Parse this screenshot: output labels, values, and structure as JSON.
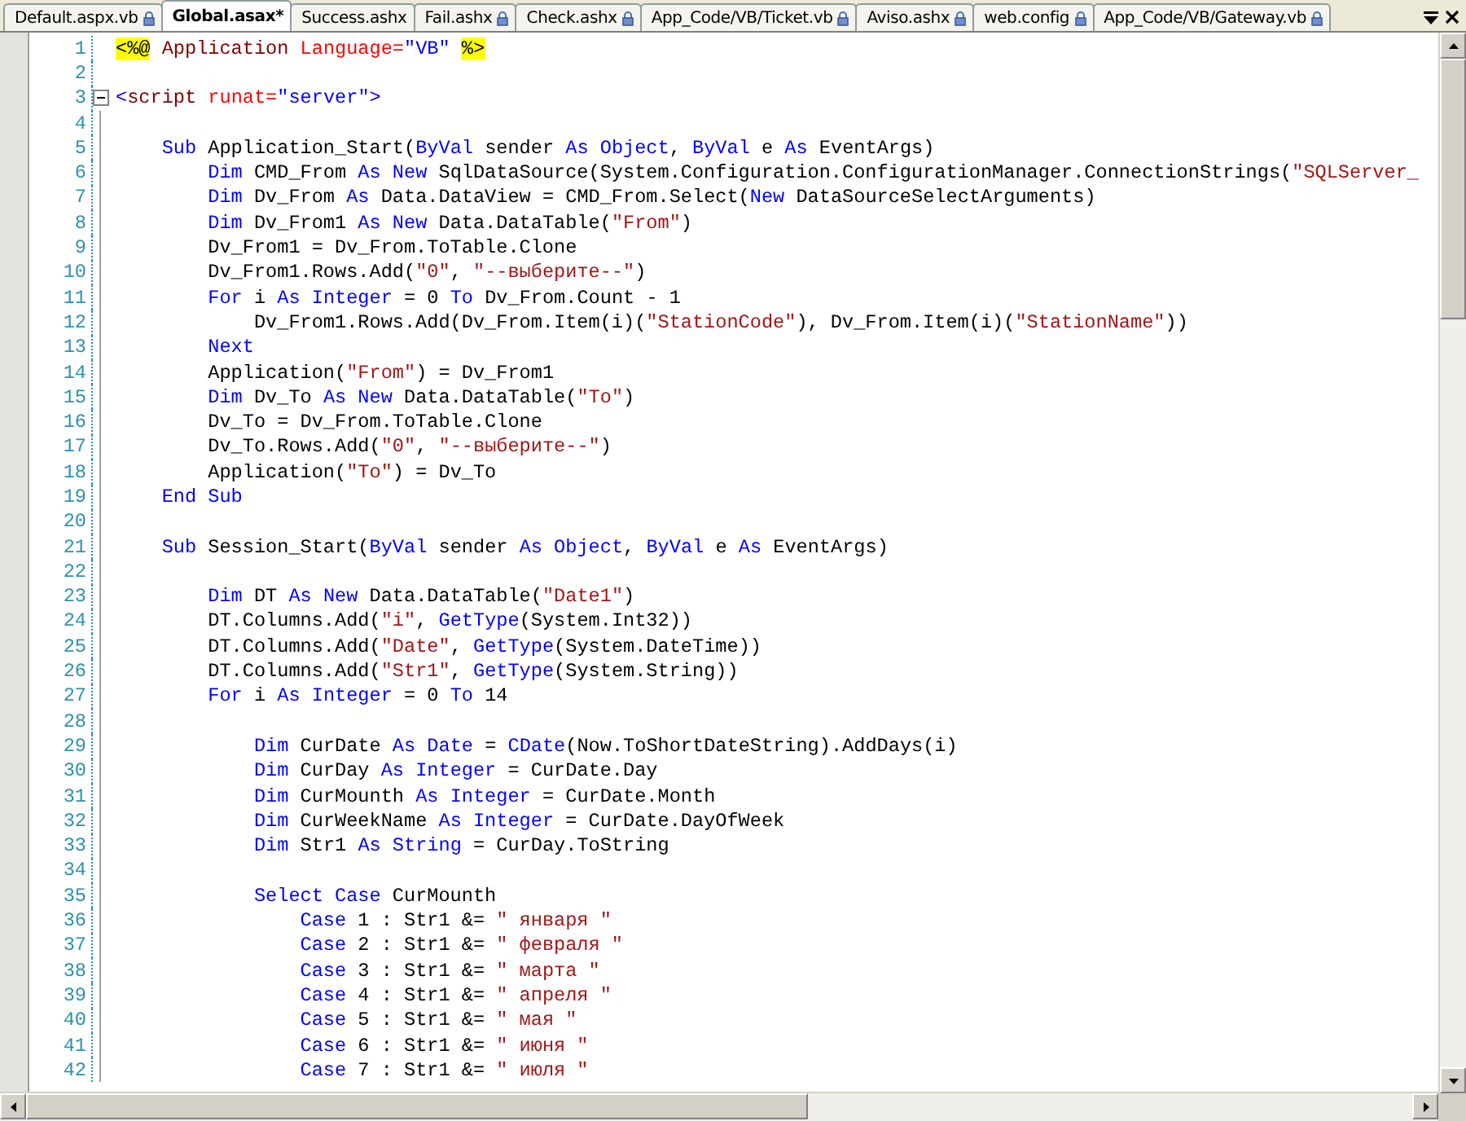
{
  "tabs": [
    {
      "label": "Default.aspx.vb",
      "selected": false,
      "locked": true
    },
    {
      "label": "Global.asax*",
      "selected": true,
      "locked": false
    },
    {
      "label": "Success.ashx",
      "selected": false,
      "locked": false
    },
    {
      "label": "Fail.ashx",
      "selected": false,
      "locked": true
    },
    {
      "label": "Check.ashx",
      "selected": false,
      "locked": true
    },
    {
      "label": "App_Code/VB/Ticket.vb",
      "selected": false,
      "locked": true
    },
    {
      "label": "Aviso.ashx",
      "selected": false,
      "locked": true
    },
    {
      "label": "web.config",
      "selected": false,
      "locked": true
    },
    {
      "label": "App_Code/VB/Gateway.vb",
      "selected": false,
      "locked": true
    }
  ],
  "lines": [
    {
      "number": "1",
      "segments": [
        {
          "kind": "asp",
          "text": "<%@"
        },
        {
          "kind": "el",
          "text": " Application"
        },
        {
          "kind": "attr",
          "text": " Language="
        },
        {
          "kind": "val",
          "text": "\"VB\" "
        },
        {
          "kind": "asp",
          "text": "%>"
        }
      ]
    },
    {
      "number": "2"
    },
    {
      "number": "3",
      "expanded": true,
      "segments": [
        {
          "kind": "val",
          "text": "<"
        },
        {
          "kind": "el",
          "text": "script"
        },
        {
          "kind": "attr",
          "text": " runat="
        },
        {
          "kind": "val",
          "text": "\"server\">"
        }
      ]
    },
    {
      "number": "4"
    },
    {
      "number": "5",
      "segments": [
        {
          "kind": "kw",
          "text": "    Sub"
        },
        {
          "kind": "plain",
          "text": " Application_Start("
        },
        {
          "kind": "kw",
          "text": "ByVal"
        },
        {
          "kind": "plain",
          "text": " sender "
        },
        {
          "kind": "kw",
          "text": "As Object"
        },
        {
          "kind": "plain",
          "text": ", "
        },
        {
          "kind": "kw",
          "text": "ByVal"
        },
        {
          "kind": "plain",
          "text": " e "
        },
        {
          "kind": "kw",
          "text": "As"
        },
        {
          "kind": "plain",
          "text": " EventArgs)"
        }
      ]
    },
    {
      "number": "6",
      "segments": [
        {
          "kind": "kw",
          "text": "        Dim"
        },
        {
          "kind": "plain",
          "text": " CMD_From "
        },
        {
          "kind": "kw",
          "text": "As New"
        },
        {
          "kind": "plain",
          "text": " SqlDataSource(System.Configuration.ConfigurationManager.ConnectionStrings("
        },
        {
          "kind": "str",
          "text": "\"SQLServer_"
        }
      ]
    },
    {
      "number": "7",
      "segments": [
        {
          "kind": "kw",
          "text": "        Dim"
        },
        {
          "kind": "plain",
          "text": " Dv_From "
        },
        {
          "kind": "kw",
          "text": "As"
        },
        {
          "kind": "plain",
          "text": " Data.DataView = CMD_From.Select("
        },
        {
          "kind": "kw",
          "text": "New"
        },
        {
          "kind": "plain",
          "text": " DataSourceSelectArguments)"
        }
      ]
    },
    {
      "number": "8",
      "segments": [
        {
          "kind": "kw",
          "text": "        Dim"
        },
        {
          "kind": "plain",
          "text": " Dv_From1 "
        },
        {
          "kind": "kw",
          "text": "As New"
        },
        {
          "kind": "plain",
          "text": " Data.DataTable("
        },
        {
          "kind": "str",
          "text": "\"From\""
        },
        {
          "kind": "plain",
          "text": ")"
        }
      ]
    },
    {
      "number": "9",
      "segments": [
        {
          "kind": "plain",
          "text": "        Dv_From1 = Dv_From.ToTable.Clone"
        }
      ]
    },
    {
      "number": "10",
      "segments": [
        {
          "kind": "plain",
          "text": "        Dv_From1.Rows.Add("
        },
        {
          "kind": "str",
          "text": "\"0\""
        },
        {
          "kind": "plain",
          "text": ", "
        },
        {
          "kind": "str",
          "text": "\"--выберите--\""
        },
        {
          "kind": "plain",
          "text": ")"
        }
      ]
    },
    {
      "number": "11",
      "segments": [
        {
          "kind": "kw",
          "text": "        For"
        },
        {
          "kind": "plain",
          "text": " i "
        },
        {
          "kind": "kw",
          "text": "As Integer"
        },
        {
          "kind": "plain",
          "text": " = 0 "
        },
        {
          "kind": "kw",
          "text": "To"
        },
        {
          "kind": "plain",
          "text": " Dv_From.Count - 1"
        }
      ]
    },
    {
      "number": "12",
      "segments": [
        {
          "kind": "plain",
          "text": "            Dv_From1.Rows.Add(Dv_From.Item(i)("
        },
        {
          "kind": "str",
          "text": "\"StationCode\""
        },
        {
          "kind": "plain",
          "text": "), Dv_From.Item(i)("
        },
        {
          "kind": "str",
          "text": "\"StationName\""
        },
        {
          "kind": "plain",
          "text": "))"
        }
      ]
    },
    {
      "number": "13",
      "segments": [
        {
          "kind": "kw",
          "text": "        Next"
        }
      ]
    },
    {
      "number": "14",
      "segments": [
        {
          "kind": "plain",
          "text": "        Application("
        },
        {
          "kind": "str",
          "text": "\"From\""
        },
        {
          "kind": "plain",
          "text": ") = Dv_From1"
        }
      ]
    },
    {
      "number": "15",
      "segments": [
        {
          "kind": "kw",
          "text": "        Dim"
        },
        {
          "kind": "plain",
          "text": " Dv_To "
        },
        {
          "kind": "kw",
          "text": "As New"
        },
        {
          "kind": "plain",
          "text": " Data.DataTable("
        },
        {
          "kind": "str",
          "text": "\"To\""
        },
        {
          "kind": "plain",
          "text": ")"
        }
      ]
    },
    {
      "number": "16",
      "segments": [
        {
          "kind": "plain",
          "text": "        Dv_To = Dv_From.ToTable.Clone"
        }
      ]
    },
    {
      "number": "17",
      "segments": [
        {
          "kind": "plain",
          "text": "        Dv_To.Rows.Add("
        },
        {
          "kind": "str",
          "text": "\"0\""
        },
        {
          "kind": "plain",
          "text": ", "
        },
        {
          "kind": "str",
          "text": "\"--выберите--\""
        },
        {
          "kind": "plain",
          "text": ")"
        }
      ]
    },
    {
      "number": "18",
      "segments": [
        {
          "kind": "plain",
          "text": "        Application("
        },
        {
          "kind": "str",
          "text": "\"To\""
        },
        {
          "kind": "plain",
          "text": ") = Dv_To"
        }
      ]
    },
    {
      "number": "19",
      "segments": [
        {
          "kind": "kw",
          "text": "    End Sub"
        }
      ]
    },
    {
      "number": "20"
    },
    {
      "number": "21",
      "segments": [
        {
          "kind": "kw",
          "text": "    Sub"
        },
        {
          "kind": "plain",
          "text": " Session_Start("
        },
        {
          "kind": "kw",
          "text": "ByVal"
        },
        {
          "kind": "plain",
          "text": " sender "
        },
        {
          "kind": "kw",
          "text": "As Object"
        },
        {
          "kind": "plain",
          "text": ", "
        },
        {
          "kind": "kw",
          "text": "ByVal"
        },
        {
          "kind": "plain",
          "text": " e "
        },
        {
          "kind": "kw",
          "text": "As"
        },
        {
          "kind": "plain",
          "text": " EventArgs)"
        }
      ]
    },
    {
      "number": "22"
    },
    {
      "number": "23",
      "segments": [
        {
          "kind": "kw",
          "text": "        Dim"
        },
        {
          "kind": "plain",
          "text": " DT "
        },
        {
          "kind": "kw",
          "text": "As New"
        },
        {
          "kind": "plain",
          "text": " Data.DataTable("
        },
        {
          "kind": "str",
          "text": "\"Date1\""
        },
        {
          "kind": "plain",
          "text": ")"
        }
      ]
    },
    {
      "number": "24",
      "segments": [
        {
          "kind": "plain",
          "text": "        DT.Columns.Add("
        },
        {
          "kind": "str",
          "text": "\"i\""
        },
        {
          "kind": "plain",
          "text": ", "
        },
        {
          "kind": "kw",
          "text": "GetType"
        },
        {
          "kind": "plain",
          "text": "(System.Int32))"
        }
      ]
    },
    {
      "number": "25",
      "segments": [
        {
          "kind": "plain",
          "text": "        DT.Columns.Add("
        },
        {
          "kind": "str",
          "text": "\"Date\""
        },
        {
          "kind": "plain",
          "text": ", "
        },
        {
          "kind": "kw",
          "text": "GetType"
        },
        {
          "kind": "plain",
          "text": "(System.DateTime))"
        }
      ]
    },
    {
      "number": "26",
      "segments": [
        {
          "kind": "plain",
          "text": "        DT.Columns.Add("
        },
        {
          "kind": "str",
          "text": "\"Str1\""
        },
        {
          "kind": "plain",
          "text": ", "
        },
        {
          "kind": "kw",
          "text": "GetType"
        },
        {
          "kind": "plain",
          "text": "(System.String))"
        }
      ]
    },
    {
      "number": "27",
      "segments": [
        {
          "kind": "kw",
          "text": "        For"
        },
        {
          "kind": "plain",
          "text": " i "
        },
        {
          "kind": "kw",
          "text": "As Integer"
        },
        {
          "kind": "plain",
          "text": " = 0 "
        },
        {
          "kind": "kw",
          "text": "To"
        },
        {
          "kind": "plain",
          "text": " 14"
        }
      ]
    },
    {
      "number": "28"
    },
    {
      "number": "29",
      "segments": [
        {
          "kind": "kw",
          "text": "            Dim"
        },
        {
          "kind": "plain",
          "text": " CurDate "
        },
        {
          "kind": "kw",
          "text": "As Date"
        },
        {
          "kind": "plain",
          "text": " = "
        },
        {
          "kind": "kw",
          "text": "CDate"
        },
        {
          "kind": "plain",
          "text": "(Now.ToShortDateString).AddDays(i)"
        }
      ]
    },
    {
      "number": "30",
      "segments": [
        {
          "kind": "kw",
          "text": "            Dim"
        },
        {
          "kind": "plain",
          "text": " CurDay "
        },
        {
          "kind": "kw",
          "text": "As Integer"
        },
        {
          "kind": "plain",
          "text": " = CurDate.Day"
        }
      ]
    },
    {
      "number": "31",
      "segments": [
        {
          "kind": "kw",
          "text": "            Dim"
        },
        {
          "kind": "plain",
          "text": " CurMounth "
        },
        {
          "kind": "kw",
          "text": "As Integer"
        },
        {
          "kind": "plain",
          "text": " = CurDate.Month"
        }
      ]
    },
    {
      "number": "32",
      "segments": [
        {
          "kind": "kw",
          "text": "            Dim"
        },
        {
          "kind": "plain",
          "text": " CurWeekName "
        },
        {
          "kind": "kw",
          "text": "As Integer"
        },
        {
          "kind": "plain",
          "text": " = CurDate.DayOfWeek"
        }
      ]
    },
    {
      "number": "33",
      "segments": [
        {
          "kind": "kw",
          "text": "            Dim"
        },
        {
          "kind": "plain",
          "text": " Str1 "
        },
        {
          "kind": "kw",
          "text": "As String"
        },
        {
          "kind": "plain",
          "text": " = CurDay.ToString"
        }
      ]
    },
    {
      "number": "34"
    },
    {
      "number": "35",
      "segments": [
        {
          "kind": "kw",
          "text": "            Select Case"
        },
        {
          "kind": "plain",
          "text": " CurMounth"
        }
      ]
    },
    {
      "number": "36",
      "segments": [
        {
          "kind": "kw",
          "text": "                Case"
        },
        {
          "kind": "plain",
          "text": " 1 : Str1 &= "
        },
        {
          "kind": "str",
          "text": "\" января \""
        }
      ]
    },
    {
      "number": "37",
      "segments": [
        {
          "kind": "kw",
          "text": "                Case"
        },
        {
          "kind": "plain",
          "text": " 2 : Str1 &= "
        },
        {
          "kind": "str",
          "text": "\" февраля \""
        }
      ]
    },
    {
      "number": "38",
      "segments": [
        {
          "kind": "kw",
          "text": "                Case"
        },
        {
          "kind": "plain",
          "text": " 3 : Str1 &= "
        },
        {
          "kind": "str",
          "text": "\" марта \""
        }
      ]
    },
    {
      "number": "39",
      "segments": [
        {
          "kind": "kw",
          "text": "                Case"
        },
        {
          "kind": "plain",
          "text": " 4 : Str1 &= "
        },
        {
          "kind": "str",
          "text": "\" апреля \""
        }
      ]
    },
    {
      "number": "40",
      "segments": [
        {
          "kind": "kw",
          "text": "                Case"
        },
        {
          "kind": "plain",
          "text": " 5 : Str1 &= "
        },
        {
          "kind": "str",
          "text": "\" мая \""
        }
      ]
    },
    {
      "number": "41",
      "segments": [
        {
          "kind": "kw",
          "text": "                Case"
        },
        {
          "kind": "plain",
          "text": " 6 : Str1 &= "
        },
        {
          "kind": "str",
          "text": "\" июня \""
        }
      ]
    },
    {
      "number": "42",
      "segments": [
        {
          "kind": "kw",
          "text": "                Case"
        },
        {
          "kind": "plain",
          "text": " 7 : Str1 &= "
        },
        {
          "kind": "str",
          "text": "\" июля \""
        }
      ]
    }
  ]
}
